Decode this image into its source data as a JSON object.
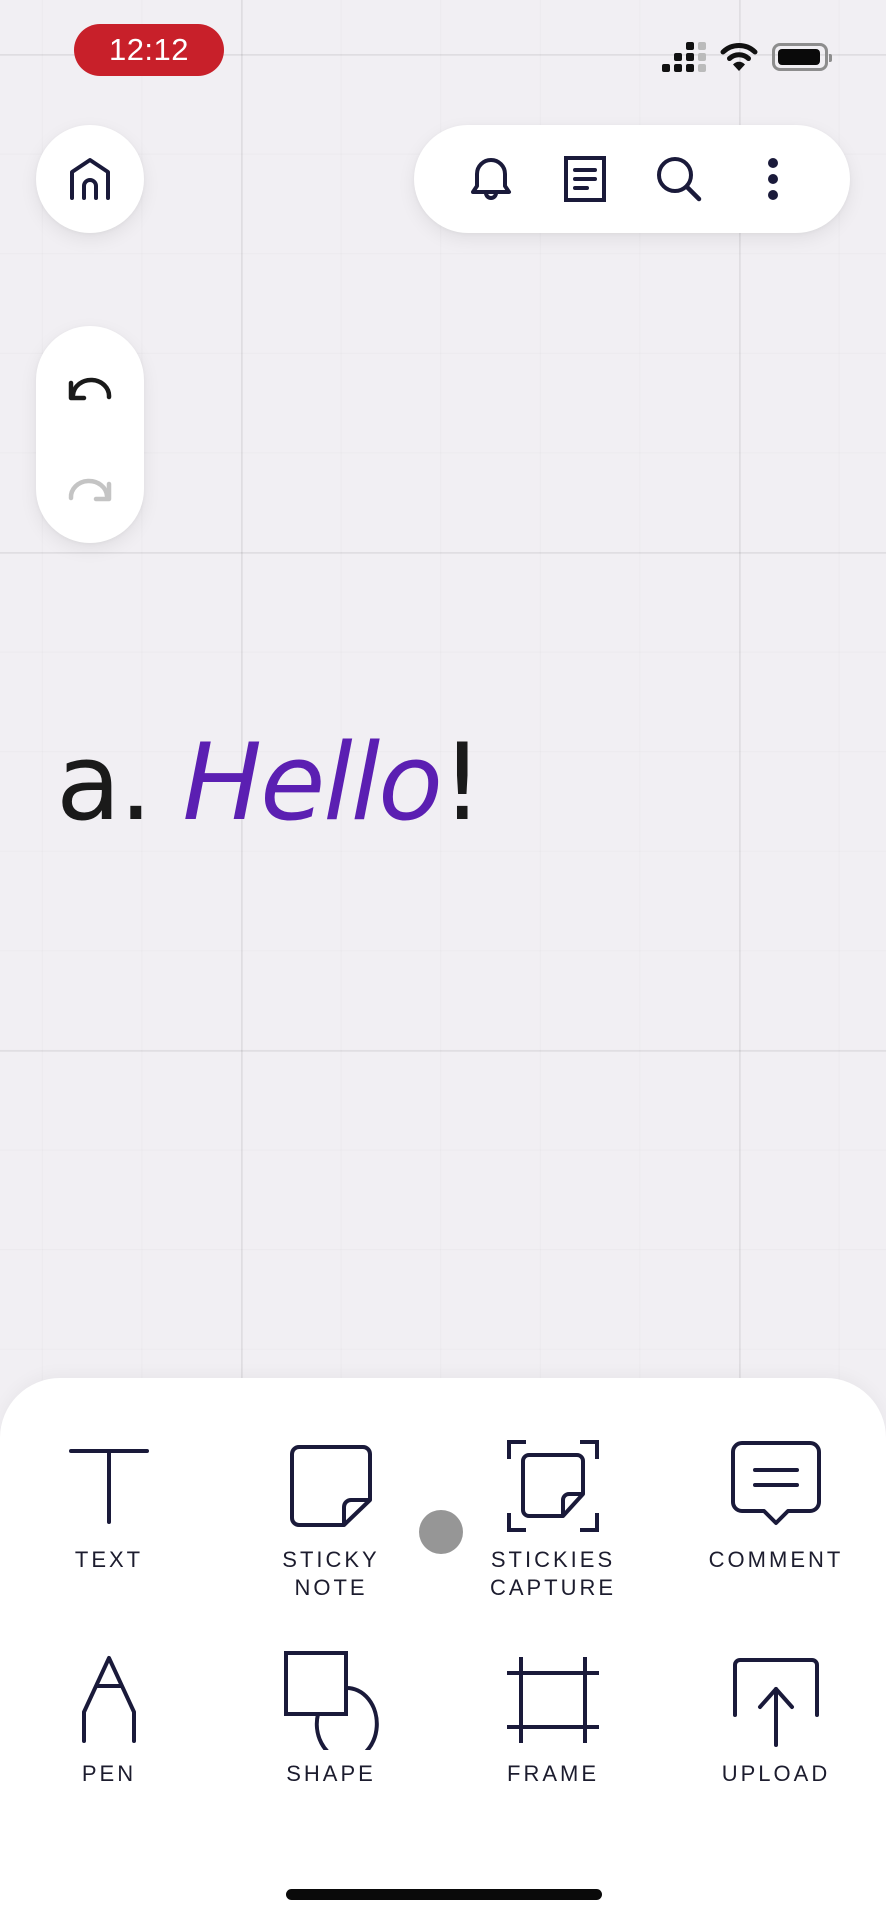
{
  "status_bar": {
    "time": "12:12",
    "clock_color": "#c8202a",
    "signal_bars_filled": 3,
    "signal_bars_total": 4,
    "wifi": "wifi-icon",
    "battery_level": 0.95
  },
  "top_left": {
    "home_icon": "home-icon"
  },
  "top_toolbar": {
    "items": [
      {
        "icon": "bell-icon",
        "label": "Notifications"
      },
      {
        "icon": "document-icon",
        "label": "Board info"
      },
      {
        "icon": "search-icon",
        "label": "Search"
      },
      {
        "icon": "more-vertical-icon",
        "label": "More"
      }
    ]
  },
  "history": {
    "undo": {
      "icon": "undo-icon",
      "enabled": true
    },
    "redo": {
      "icon": "redo-icon",
      "enabled": false
    }
  },
  "canvas": {
    "text_prefix": "a. ",
    "text_highlight": "Hello",
    "text_suffix": "!",
    "highlight_color": "#5b1fb2",
    "text_color": "#1a1a1a"
  },
  "tools": [
    {
      "id": "text",
      "label": "TEXT",
      "icon": "text-tool-icon"
    },
    {
      "id": "sticky-note",
      "label": "STICKY NOTE",
      "icon": "sticky-note-icon"
    },
    {
      "id": "stickies-capture",
      "label": "STICKIES CAPTURE",
      "icon": "stickies-capture-icon"
    },
    {
      "id": "comment",
      "label": "COMMENT",
      "icon": "comment-icon"
    },
    {
      "id": "pen",
      "label": "PEN",
      "icon": "pen-icon"
    },
    {
      "id": "shape",
      "label": "SHAPE",
      "icon": "shape-icon"
    },
    {
      "id": "frame",
      "label": "FRAME",
      "icon": "frame-icon"
    },
    {
      "id": "upload",
      "label": "UPLOAD",
      "icon": "upload-icon"
    }
  ],
  "colors": {
    "icon_ink": "#1a1a3a",
    "canvas_bg": "#f1eff3",
    "touch_indicator": "#969696"
  }
}
